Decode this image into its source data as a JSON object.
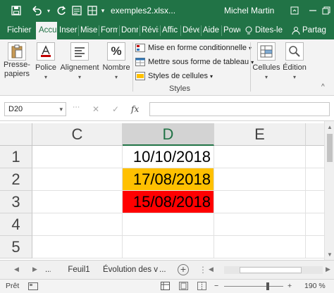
{
  "titlebar": {
    "filename": "exemples2.xlsx...",
    "user": "Michel Martin"
  },
  "tabs": [
    {
      "label": "Fichier",
      "active": false
    },
    {
      "label": "Accu",
      "active": true
    },
    {
      "label": "Inser",
      "active": false
    },
    {
      "label": "Mise",
      "active": false
    },
    {
      "label": "Form",
      "active": false
    },
    {
      "label": "Donr",
      "active": false
    },
    {
      "label": "Révis",
      "active": false
    },
    {
      "label": "Affic",
      "active": false
    },
    {
      "label": "Déve",
      "active": false
    },
    {
      "label": "Aide",
      "active": false
    },
    {
      "label": "Powe",
      "active": false
    },
    {
      "label": "Dites-le",
      "active": false
    },
    {
      "label": "Partag",
      "active": false
    }
  ],
  "ribbon": {
    "presse_papiers": "Presse-papiers",
    "police": "Police",
    "alignement": "Alignement",
    "nombre": "Nombre",
    "mise_en_forme": "Mise en forme conditionnelle",
    "mettre_sous_forme": "Mettre sous forme de tableau",
    "styles_cellules": "Styles de cellules",
    "styles_group": "Styles",
    "cellules": "Cellules",
    "edition": "Édition"
  },
  "formulabar": {
    "namebox": "D20",
    "fx": "fx",
    "formula": ""
  },
  "grid": {
    "columns": [
      "C",
      "D",
      "E"
    ],
    "selected_column": "D",
    "rows": [
      {
        "num": "1",
        "d": "10/10/2018",
        "fill": "#ffffff"
      },
      {
        "num": "2",
        "d": "17/08/2018",
        "fill": "#ffc000"
      },
      {
        "num": "3",
        "d": "15/08/2018",
        "fill": "#ff0000"
      },
      {
        "num": "4",
        "d": "",
        "fill": "#ffffff"
      },
      {
        "num": "5",
        "d": "",
        "fill": "#ffffff"
      }
    ]
  },
  "sheets": {
    "tab1": "Feuil1",
    "tab2": "Évolution des v",
    "more": "..."
  },
  "status": {
    "ready": "Prêt",
    "zoom": "190 %",
    "zoom_minus": "−",
    "zoom_plus": "+"
  }
}
